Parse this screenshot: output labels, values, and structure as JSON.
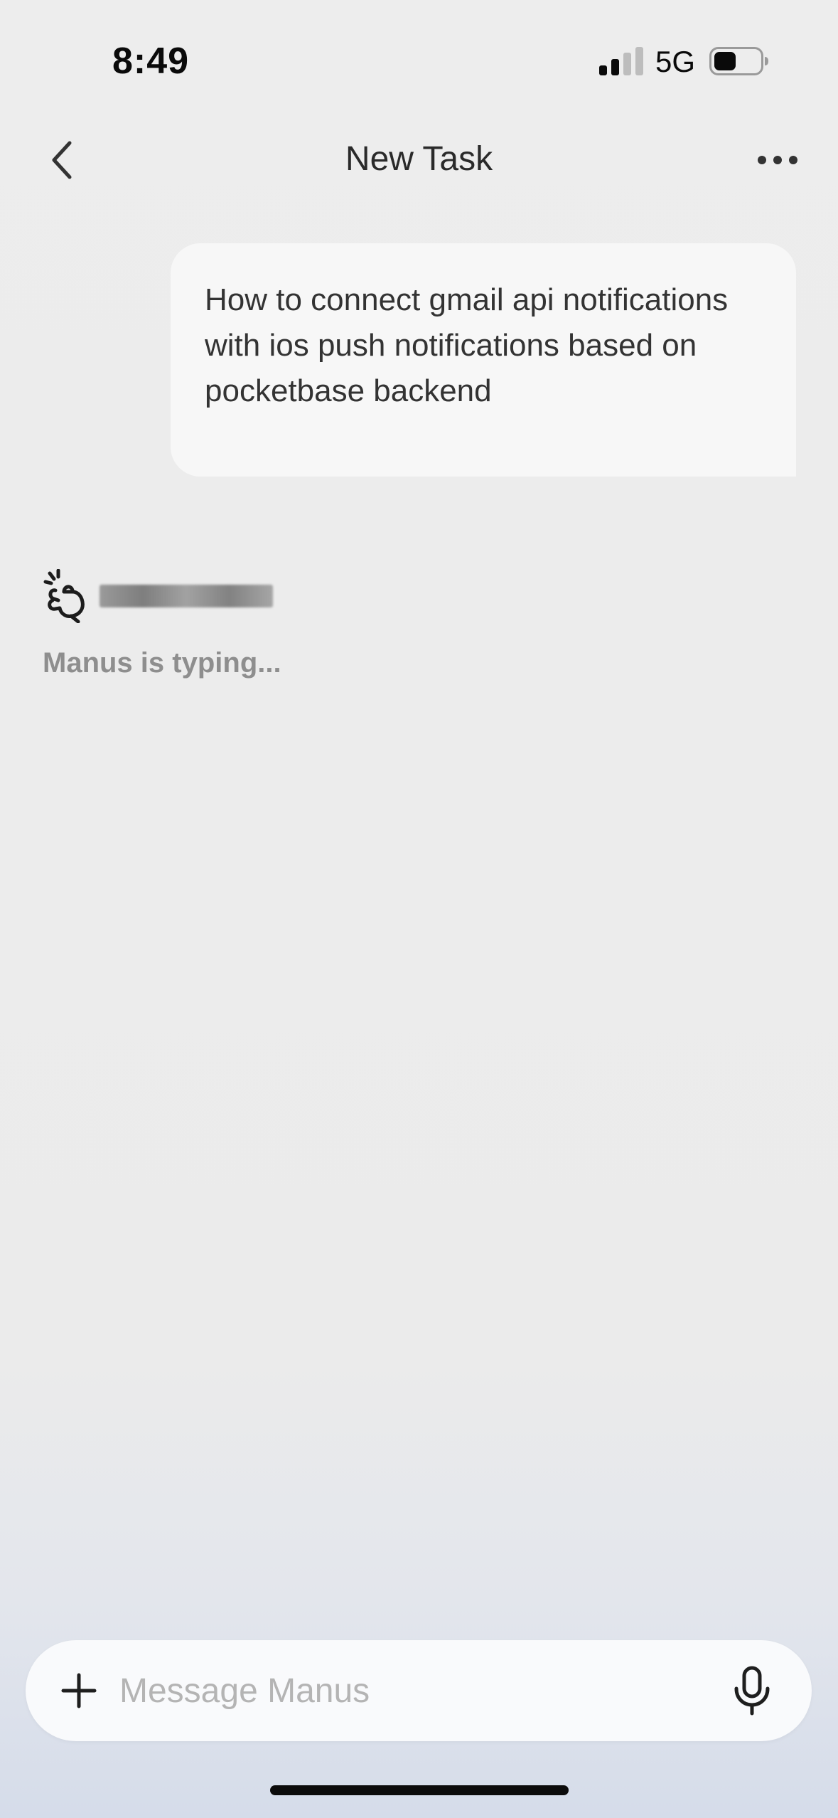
{
  "status_bar": {
    "time": "8:49",
    "network": "5G",
    "signal_icon": "cellular-signal-icon",
    "battery_icon": "battery-icon"
  },
  "header": {
    "title": "New Task",
    "back_icon": "chevron-left-icon",
    "more_icon": "ellipsis-icon"
  },
  "conversation": {
    "user_message": "How to connect gmail api notifications with ios push notifications based on pocketbase backend",
    "assistant": {
      "logo_icon": "manus-hand-logo-icon",
      "name_redacted": "",
      "typing_status": "Manus is typing..."
    }
  },
  "composer": {
    "placeholder": "Message Manus",
    "value": "",
    "attach_icon": "plus-icon",
    "mic_icon": "microphone-icon"
  },
  "colors": {
    "background": "#ededed",
    "bubble": "#f7f7f7",
    "text_primary": "#2b2b2b",
    "text_muted": "#8e8e8e",
    "placeholder": "#b4b4b4"
  }
}
